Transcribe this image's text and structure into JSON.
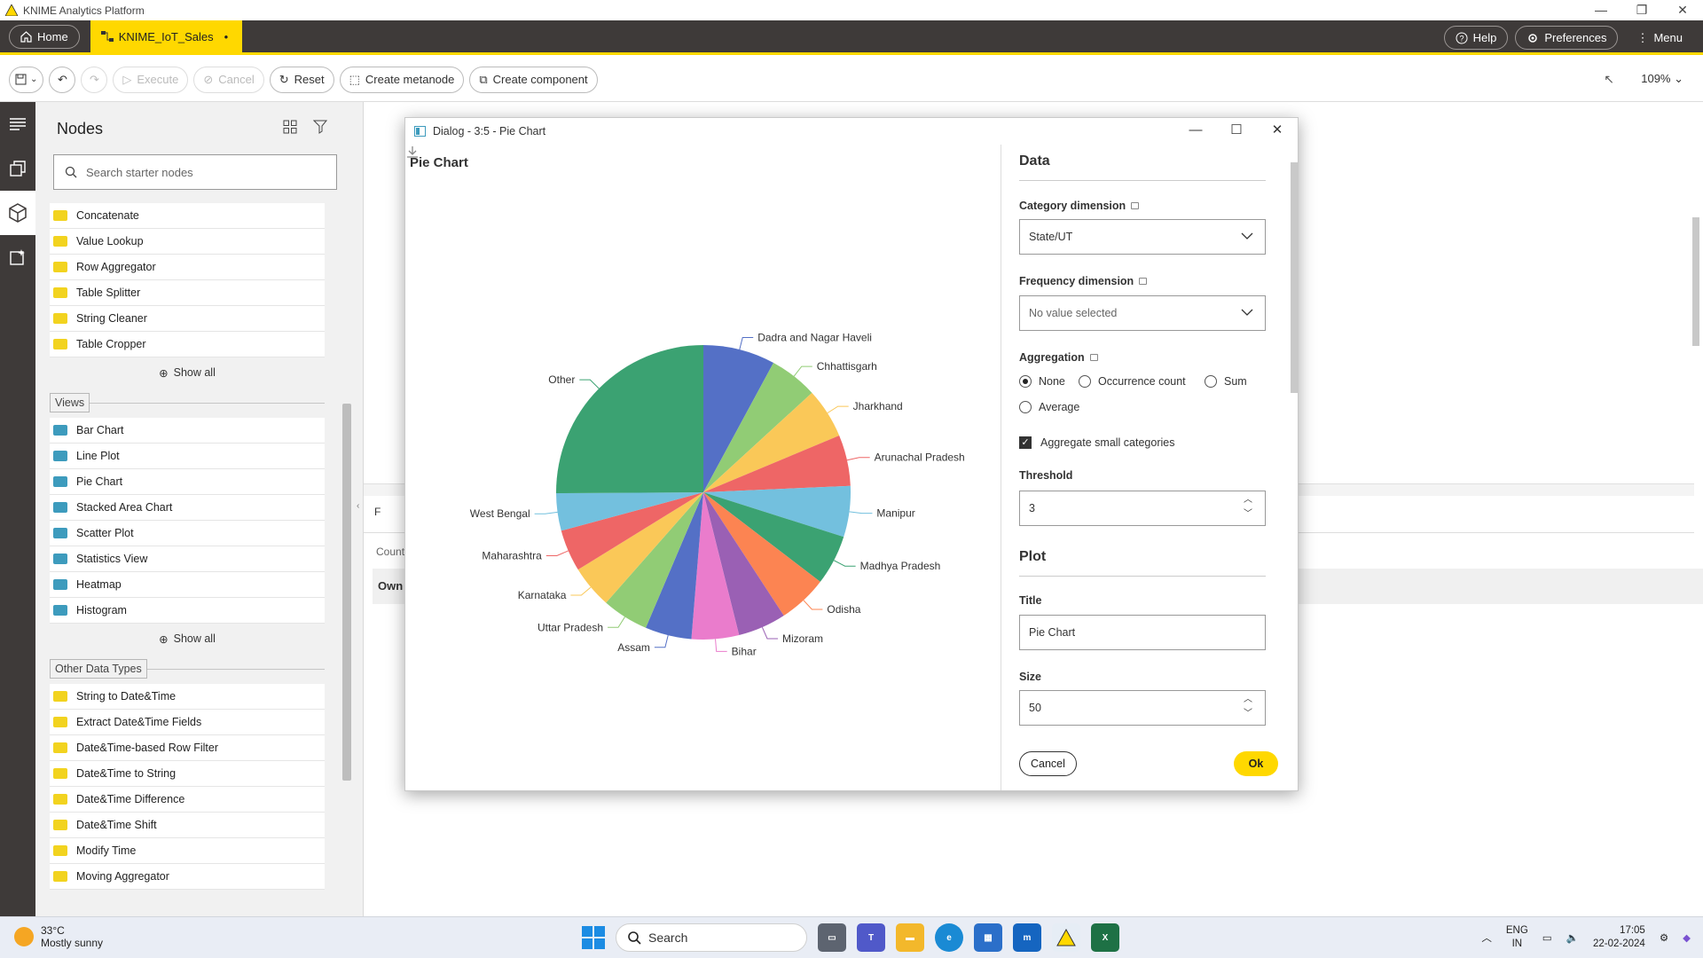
{
  "window": {
    "title": "KNIME Analytics Platform",
    "controls": [
      "—",
      "❐",
      "✕"
    ]
  },
  "header": {
    "home_label": "Home",
    "workflow_tab": "KNIME_IoT_Sales",
    "workflow_dirty": "•",
    "help": "Help",
    "preferences": "Preferences",
    "menu": "Menu",
    "accent": "#ffd800"
  },
  "toolbar": {
    "execute": "Execute",
    "cancel": "Cancel",
    "reset": "Reset",
    "create_metanode": "Create metanode",
    "create_component": "Create component",
    "zoom": "109%"
  },
  "nodes_panel": {
    "title": "Nodes",
    "search_placeholder": "Search starter nodes",
    "group1": [
      "Concatenate",
      "Value Lookup",
      "Row Aggregator",
      "Table Splitter",
      "String Cleaner",
      "Table Cropper"
    ],
    "show_all": "Show all",
    "views_label": "Views",
    "views": [
      "Bar Chart",
      "Line Plot",
      "Pie Chart",
      "Stacked Area Chart",
      "Scatter Plot",
      "Statistics View",
      "Heatmap",
      "Histogram"
    ],
    "other_label": "Other Data Types",
    "other": [
      "String to Date&Time",
      "Extract Date&Time Fields",
      "Date&Time-based Row Filter",
      "Date&Time to String",
      "Date&Time Difference",
      "Date&Time Shift",
      "Modify Time",
      "Moving Aggregator"
    ]
  },
  "canvas": {
    "tab_label": "F",
    "count_label": "Count",
    "row_label": "Own"
  },
  "dialog": {
    "title": "Dialog - 3:5 - Pie Chart",
    "data_section": "Data",
    "category_label": "Category dimension",
    "category_value": "State/UT",
    "frequency_label": "Frequency dimension",
    "frequency_value": "No value selected",
    "aggregation_label": "Aggregation",
    "agg_none": "None",
    "agg_occurrence": "Occurrence count",
    "agg_sum": "Sum",
    "agg_average": "Average",
    "aggregate_small": "Aggregate small categories",
    "threshold_label": "Threshold",
    "threshold_value": "3",
    "plot_section": "Plot",
    "title_label": "Title",
    "title_value": "Pie Chart",
    "size_label": "Size",
    "size_value": "50",
    "cancel": "Cancel",
    "ok": "Ok"
  },
  "chart_data": {
    "type": "pie",
    "title": "Pie Chart",
    "labels": [
      "Dadra and Nagar Haveli",
      "Chhattisgarh",
      "Jharkhand",
      "Arunachal Pradesh",
      "Manipur",
      "Madhya Pradesh",
      "Odisha",
      "Mizoram",
      "Bihar",
      "Assam",
      "Uttar Pradesh",
      "Karnataka",
      "Maharashtra",
      "West Bengal",
      "Other"
    ],
    "values": [
      7.9,
      5.3,
      5.5,
      5.6,
      5.6,
      5.5,
      5.4,
      5.3,
      5.2,
      5.1,
      5.1,
      4.7,
      4.6,
      4.1,
      25.1
    ],
    "colors": [
      "#5470c6",
      "#91cc75",
      "#fac858",
      "#ee6666",
      "#73c0de",
      "#3ba272",
      "#fc8452",
      "#9a60b4",
      "#ea7ccc",
      "#5470c6",
      "#91cc75",
      "#fac858",
      "#ee6666",
      "#73c0de",
      "#3ba272"
    ]
  },
  "taskbar": {
    "temp": "33°C",
    "weather": "Mostly sunny",
    "search": "Search",
    "lang1": "ENG",
    "lang2": "IN",
    "time": "17:05",
    "date": "22-02-2024"
  }
}
